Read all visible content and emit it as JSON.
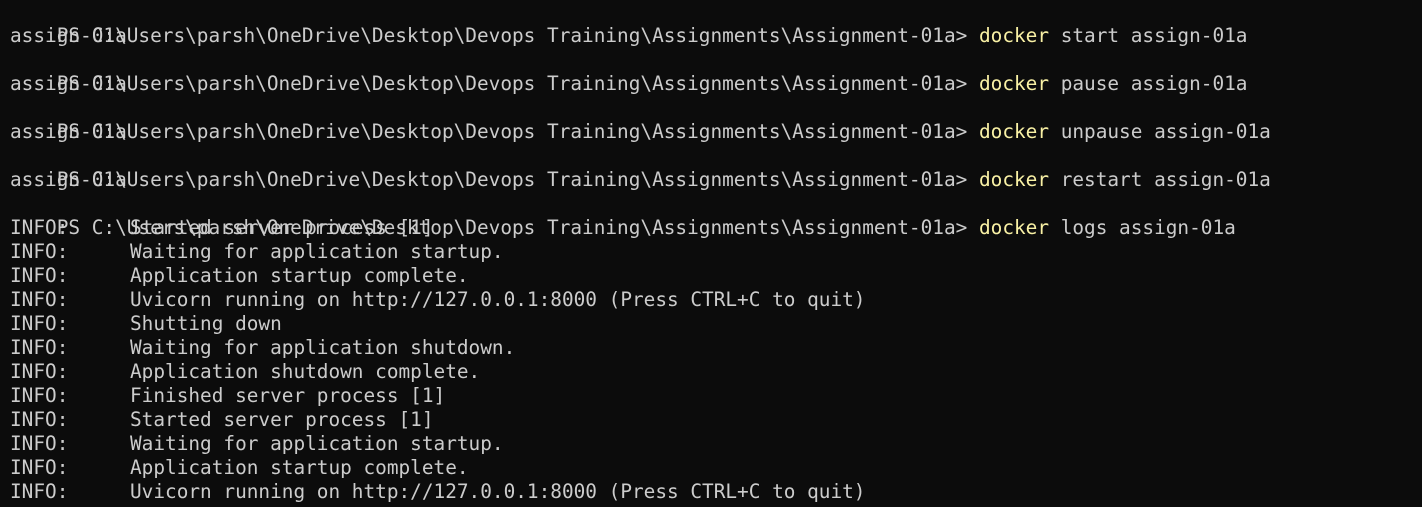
{
  "terminal": {
    "prompt": "PS C:\\Users\\parsh\\OneDrive\\Desktop\\Devops Training\\Assignments\\Assignment-01a> ",
    "colors": {
      "background": "#0c0c0c",
      "foreground": "#cccccc",
      "command": "#f9f1a5"
    },
    "entries": [
      {
        "command": "docker",
        "args": " start assign-01a",
        "output": "assign-01a"
      },
      {
        "command": "docker",
        "args": " pause assign-01a",
        "output": "assign-01a"
      },
      {
        "command": "docker",
        "args": " unpause assign-01a",
        "output": "assign-01a"
      },
      {
        "command": "docker",
        "args": " restart assign-01a",
        "output": "assign-01a"
      }
    ],
    "logs_command": {
      "command": "docker",
      "args": " logs assign-01a"
    },
    "log_lines": [
      {
        "level": "INFO:",
        "message": "Started server process [1]"
      },
      {
        "level": "INFO:",
        "message": "Waiting for application startup."
      },
      {
        "level": "INFO:",
        "message": "Application startup complete."
      },
      {
        "level": "INFO:",
        "message": "Uvicorn running on http://127.0.0.1:8000 (Press CTRL+C to quit)"
      },
      {
        "level": "INFO:",
        "message": "Shutting down"
      },
      {
        "level": "INFO:",
        "message": "Waiting for application shutdown."
      },
      {
        "level": "INFO:",
        "message": "Application shutdown complete."
      },
      {
        "level": "INFO:",
        "message": "Finished server process [1]"
      },
      {
        "level": "INFO:",
        "message": "Started server process [1]"
      },
      {
        "level": "INFO:",
        "message": "Waiting for application startup."
      },
      {
        "level": "INFO:",
        "message": "Application startup complete."
      },
      {
        "level": "INFO:",
        "message": "Uvicorn running on http://127.0.0.1:8000 (Press CTRL+C to quit)"
      }
    ]
  }
}
